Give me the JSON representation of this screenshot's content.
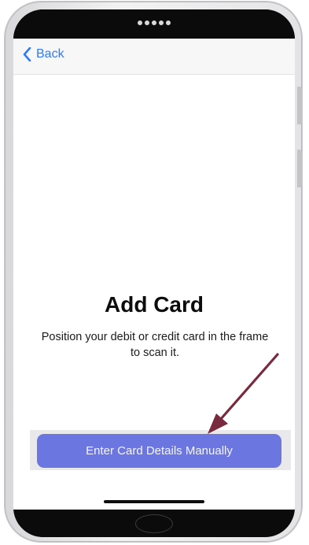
{
  "nav": {
    "back_label": "Back"
  },
  "main": {
    "title": "Add Card",
    "subtitle": "Position your debit or credit card in the frame to scan it.",
    "manual_button_label": "Enter Card Details Manually"
  },
  "colors": {
    "accent": "#2f7bf6",
    "button": "#6c76e0",
    "annotation_arrow": "#7a2a3e"
  },
  "icons": {
    "back": "chevron-left-icon",
    "annotation": "arrow-icon"
  }
}
